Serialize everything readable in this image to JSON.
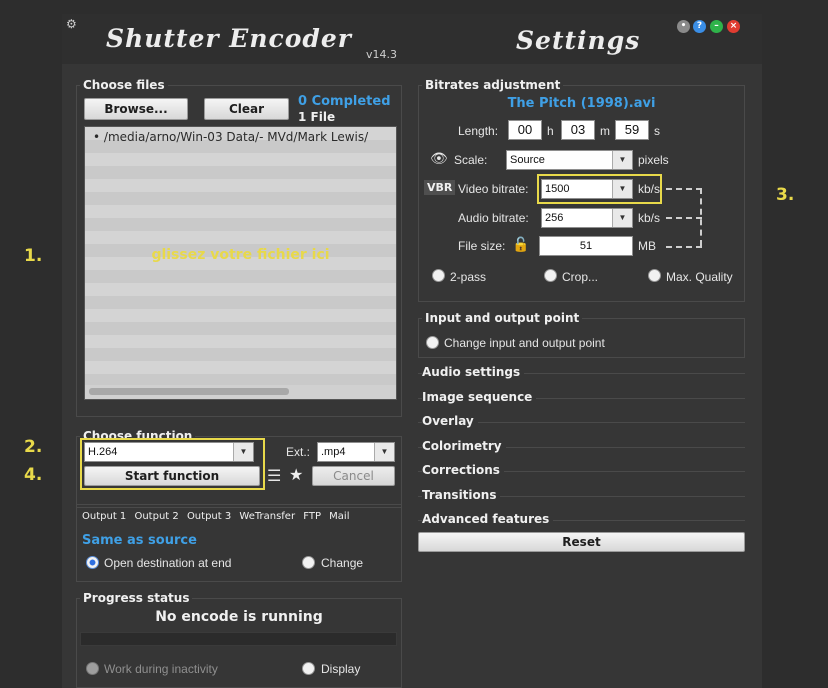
{
  "annotations": {
    "step1": "1.",
    "step2": "2.",
    "step3": "3.",
    "step4": "4."
  },
  "titlebar": {
    "app_title": "Shutter Encoder",
    "version": "v14.3",
    "settings_title": "Settings",
    "buttons": [
      "minimize",
      "help",
      "maximize",
      "close"
    ],
    "colors": {
      "help": "#3a8ee6",
      "maximize": "#2fb34a",
      "close": "#e03c31",
      "minimize": "#8a8a8a"
    }
  },
  "choose_files": {
    "title": "Choose files",
    "browse_label": "Browse...",
    "clear_label": "Clear",
    "completed": "0 Completed",
    "file_count": "1 File",
    "file_entry": "/media/arno/Win-03 Data/- MVd/Mark Lewis/",
    "drop_hint": "glissez votre fichier ici"
  },
  "choose_function": {
    "title": "Choose function",
    "function_value": "H.264",
    "ext_label": "Ext.:",
    "ext_value": ".mp4",
    "start_label": "Start function",
    "cancel_label": "Cancel"
  },
  "output": {
    "tabs": [
      "Output 1",
      "Output 2",
      "Output 3",
      "WeTransfer",
      "FTP",
      "Mail"
    ],
    "destination": "Same as source",
    "open_dest_label": "Open destination at end",
    "change_label": "Change"
  },
  "progress": {
    "title": "Progress status",
    "status": "No encode is running",
    "work_inactivity_label": "Work during inactivity",
    "display_label": "Display"
  },
  "bitrates": {
    "title": "Bitrates adjustment",
    "filename": "The Pitch (1998).avi",
    "length_label": "Length:",
    "hours": "00",
    "h_unit": "h",
    "minutes": "03",
    "m_unit": "m",
    "seconds": "59",
    "s_unit": "s",
    "scale_label": "Scale:",
    "scale_value": "Source",
    "scale_unit": "pixels",
    "vbr_badge": "VBR",
    "video_label": "Video bitrate:",
    "video_value": "1500",
    "video_unit": "kb/s",
    "audio_label": "Audio bitrate:",
    "audio_value": "256",
    "audio_unit": "kb/s",
    "filesize_label": "File size:",
    "filesize_value": "51",
    "filesize_unit": "MB",
    "twopass_label": "2-pass",
    "crop_label": "Crop...",
    "maxq_label": "Max. Quality"
  },
  "io_point": {
    "title": "Input and output point",
    "change_label": "Change input and output point"
  },
  "sections": [
    "Audio settings",
    "Image sequence",
    "Overlay",
    "Colorimetry",
    "Corrections",
    "Transitions",
    "Advanced features"
  ],
  "reset_label": "Reset"
}
